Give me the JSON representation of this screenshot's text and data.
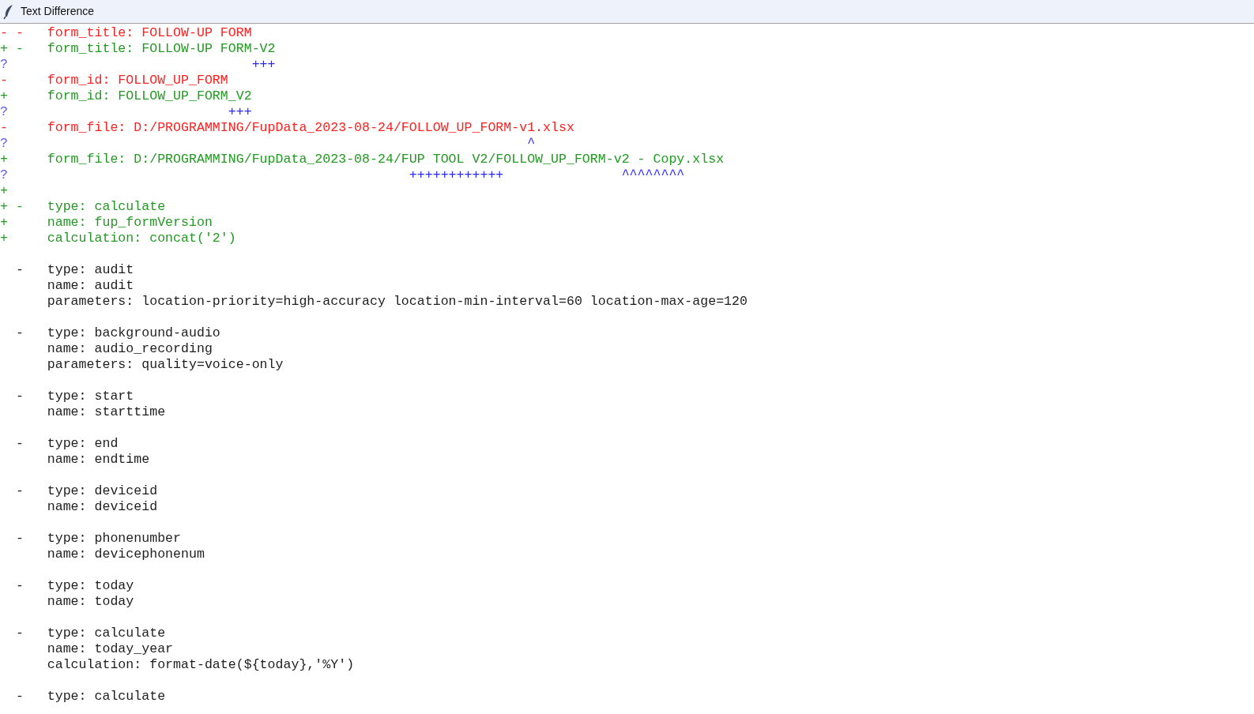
{
  "window": {
    "title": "Text Difference"
  },
  "lines": [
    {
      "kind": "removed",
      "sign": "-",
      "flag": "-",
      "content": "form_title: FOLLOW-UP FORM"
    },
    {
      "kind": "added",
      "sign": "+",
      "flag": "-",
      "content": "form_title: FOLLOW-UP FORM-V2"
    },
    {
      "kind": "hint",
      "sign": "?",
      "content": "                          +++"
    },
    {
      "kind": "removed",
      "sign": "-",
      "content": "form_id: FOLLOW_UP_FORM"
    },
    {
      "kind": "added",
      "sign": "+",
      "content": "form_id: FOLLOW_UP_FORM_V2"
    },
    {
      "kind": "hint",
      "sign": "?",
      "content": "                       +++"
    },
    {
      "kind": "removed",
      "sign": "-",
      "content": "form_file: D:/PROGRAMMING/FupData_2023-08-24/FOLLOW_UP_FORM-v1.xlsx"
    },
    {
      "kind": "hint",
      "sign": "?",
      "content": "                                                             ^"
    },
    {
      "kind": "added",
      "sign": "+",
      "content": "form_file: D:/PROGRAMMING/FupData_2023-08-24/FUP TOOL V2/FOLLOW_UP_FORM-v2 - Copy.xlsx"
    },
    {
      "kind": "hint",
      "sign": "?",
      "content": "                                              ++++++++++++               ^^^^^^^^"
    },
    {
      "kind": "added",
      "sign": "+"
    },
    {
      "kind": "added",
      "sign": "+",
      "flag": "-",
      "content": "type: calculate"
    },
    {
      "kind": "added",
      "sign": "+",
      "content": "name: fup_formVersion"
    },
    {
      "kind": "added",
      "sign": "+",
      "content": "calculation: concat('2')"
    },
    {
      "kind": "blank"
    },
    {
      "kind": "context",
      "flag": "-",
      "content": "type: audit"
    },
    {
      "kind": "context",
      "content": "name: audit"
    },
    {
      "kind": "context",
      "content": "parameters: location-priority=high-accuracy location-min-interval=60 location-max-age=120"
    },
    {
      "kind": "blank"
    },
    {
      "kind": "context",
      "flag": "-",
      "content": "type: background-audio"
    },
    {
      "kind": "context",
      "content": "name: audio_recording"
    },
    {
      "kind": "context",
      "content": "parameters: quality=voice-only"
    },
    {
      "kind": "blank"
    },
    {
      "kind": "context",
      "flag": "-",
      "content": "type: start"
    },
    {
      "kind": "context",
      "content": "name: starttime"
    },
    {
      "kind": "blank"
    },
    {
      "kind": "context",
      "flag": "-",
      "content": "type: end"
    },
    {
      "kind": "context",
      "content": "name: endtime"
    },
    {
      "kind": "blank"
    },
    {
      "kind": "context",
      "flag": "-",
      "content": "type: deviceid"
    },
    {
      "kind": "context",
      "content": "name: deviceid"
    },
    {
      "kind": "blank"
    },
    {
      "kind": "context",
      "flag": "-",
      "content": "type: phonenumber"
    },
    {
      "kind": "context",
      "content": "name: devicephonenum"
    },
    {
      "kind": "blank"
    },
    {
      "kind": "context",
      "flag": "-",
      "content": "type: today"
    },
    {
      "kind": "context",
      "content": "name: today"
    },
    {
      "kind": "blank"
    },
    {
      "kind": "context",
      "flag": "-",
      "content": "type: calculate"
    },
    {
      "kind": "context",
      "content": "name: today_year"
    },
    {
      "kind": "context",
      "content": "calculation: format-date(${today},'%Y')"
    },
    {
      "kind": "blank"
    },
    {
      "kind": "context",
      "flag": "-",
      "content": "type: calculate"
    }
  ]
}
